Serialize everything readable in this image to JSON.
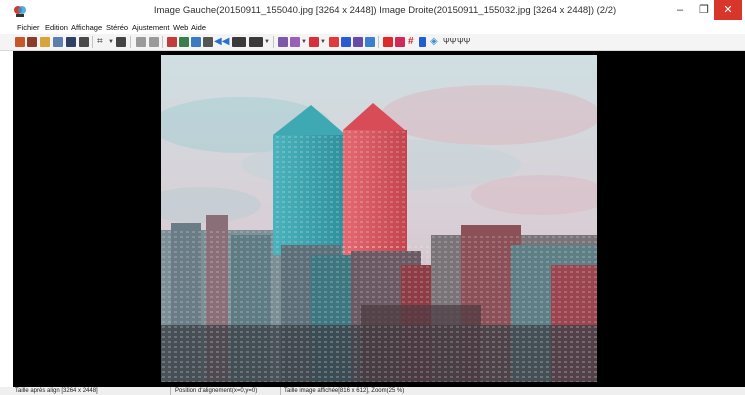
{
  "window": {
    "title": "Image Gauche(20150911_155040.jpg [3264 x 2448]) Image Droite(20150911_155032.jpg [3264 x 2448])  (2/2)",
    "minimize_glyph": "–",
    "restore_glyph": "❐",
    "close_glyph": "✕"
  },
  "menu": {
    "items": [
      {
        "label": "Fichier"
      },
      {
        "label": "Edition"
      },
      {
        "label": "Affichage"
      },
      {
        "label": "Stéréo"
      },
      {
        "label": "Ajustement"
      },
      {
        "label": "Web"
      },
      {
        "label": "Aide"
      }
    ]
  },
  "toolbar": {
    "buttons": [
      {
        "icon": "open-left-icon",
        "color": "#c9562a"
      },
      {
        "icon": "open-right-icon",
        "color": "#8e3b2b"
      },
      {
        "icon": "open-folder-icon",
        "color": "#d6a43a"
      },
      {
        "icon": "copy-icon",
        "color": "#5a7fb0"
      },
      {
        "icon": "save-icon",
        "color": "#2f3f66"
      },
      {
        "icon": "print-icon",
        "color": "#4a4a4a"
      },
      {
        "icon": "crop-icon",
        "color": "#333333"
      },
      {
        "icon": "grid-icon",
        "color": "#444444"
      },
      {
        "icon": "undo-icon",
        "color": "#9a9a9a"
      },
      {
        "icon": "redo-icon",
        "color": "#9a9a9a"
      },
      {
        "icon": "color-picker-icon",
        "color": "#c23c3c"
      },
      {
        "icon": "anaglyph-icon",
        "color": "#3c7d4c"
      },
      {
        "icon": "side-by-side-icon",
        "color": "#3b79c0"
      },
      {
        "icon": "fit-icon",
        "color": "#555555"
      },
      {
        "icon": "previous-icon",
        "color": "#2b6fd1"
      },
      {
        "icon": "zoom-icon",
        "color": "#3a3a3a"
      },
      {
        "icon": "zoom-level-icon",
        "color": "#3a3a3a"
      },
      {
        "icon": "mode-purple-icon",
        "color": "#7c5aa8"
      },
      {
        "icon": "mode-violet-icon",
        "color": "#9b5fb8"
      },
      {
        "icon": "mode-red-icon",
        "color": "#d7303b"
      },
      {
        "icon": "mode-red2-icon",
        "color": "#e03a3a"
      },
      {
        "icon": "mode-blue-icon",
        "color": "#2a5bd7"
      },
      {
        "icon": "mode-purple2-icon",
        "color": "#6a4aa8"
      },
      {
        "icon": "mode-mix-icon",
        "color": "#3b7fd0"
      },
      {
        "icon": "red-cyan-icon",
        "color": "#e02a2a"
      },
      {
        "icon": "red-cyan-text-icon",
        "color": "#d12a5a"
      },
      {
        "icon": "hash-icon",
        "color": "#d12a2a"
      },
      {
        "icon": "bars-icon",
        "color": "#1f5fd1"
      },
      {
        "icon": "diamond-icon",
        "color": "#3a8fd1"
      },
      {
        "icon": "text-tt-icon",
        "color": "#444444"
      },
      {
        "icon": "text-tt2-icon",
        "color": "#444444"
      }
    ]
  },
  "status": {
    "segments": [
      {
        "label": "Taille après align [3264 x 2448]"
      },
      {
        "label": "Position d'alignement(x=0,y=0)"
      },
      {
        "label": "Taille image affichée[816 x 612], Zoom(25 %)"
      }
    ]
  }
}
